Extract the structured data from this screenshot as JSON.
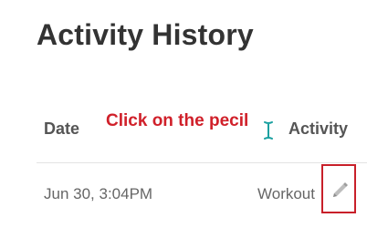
{
  "page": {
    "title": "Activity History"
  },
  "table": {
    "headers": {
      "date": "Date",
      "activity": "Activity"
    },
    "rows": [
      {
        "date": "Jun 30, 3:04PM",
        "activity": "Workout",
        "action_icon": "pencil-icon"
      }
    ]
  },
  "annotation": {
    "text": "Click on the pecil",
    "color": "#d0202a",
    "highlight_color": "#c8202a"
  }
}
